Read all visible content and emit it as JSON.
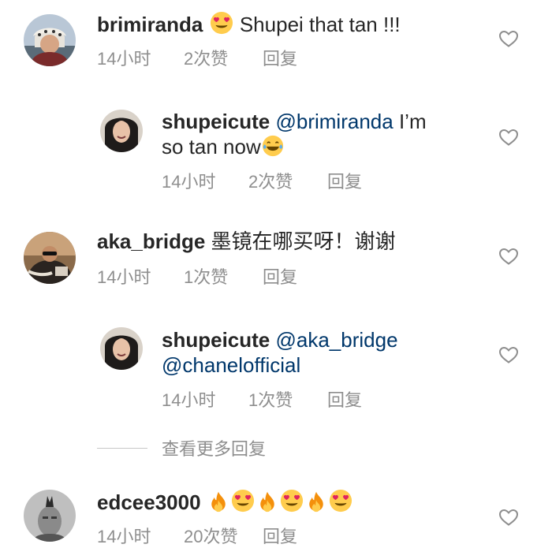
{
  "comments": [
    {
      "username": "brimiranda",
      "text": "Shupei that tan !!!",
      "time": "14小时",
      "likes": "2次赞",
      "reply": "回复"
    },
    {
      "username": "shupeicute",
      "mention": "@brimiranda",
      "text_line1_end": " I’m",
      "text_line2": "so tan now",
      "time": "14小时",
      "likes": "2次赞",
      "reply": "回复"
    },
    {
      "username": "aka_bridge",
      "text": " 墨镜在哪买呀！谢谢",
      "time": "14小时",
      "likes": "1次赞",
      "reply": "回复"
    },
    {
      "username": "shupeicute",
      "mention1": "@aka_bridge",
      "mention2": "@chanelofficial",
      "time": "14小时",
      "likes": "1次赞",
      "reply": "回复"
    },
    {
      "username": "edcee3000",
      "time": "14小时",
      "likes": "20次赞",
      "reply": "回复"
    }
  ],
  "view_more": "查看更多回复",
  "icons": {
    "like": "heart-outline-icon",
    "emoji_heart_eyes": "heart-eyes-emoji-icon",
    "emoji_laugh": "tears-of-joy-emoji-icon",
    "emoji_fire": "fire-emoji-icon"
  },
  "colors": {
    "text": "#262626",
    "secondary": "#8e8e8e",
    "mention": "#00376b"
  }
}
